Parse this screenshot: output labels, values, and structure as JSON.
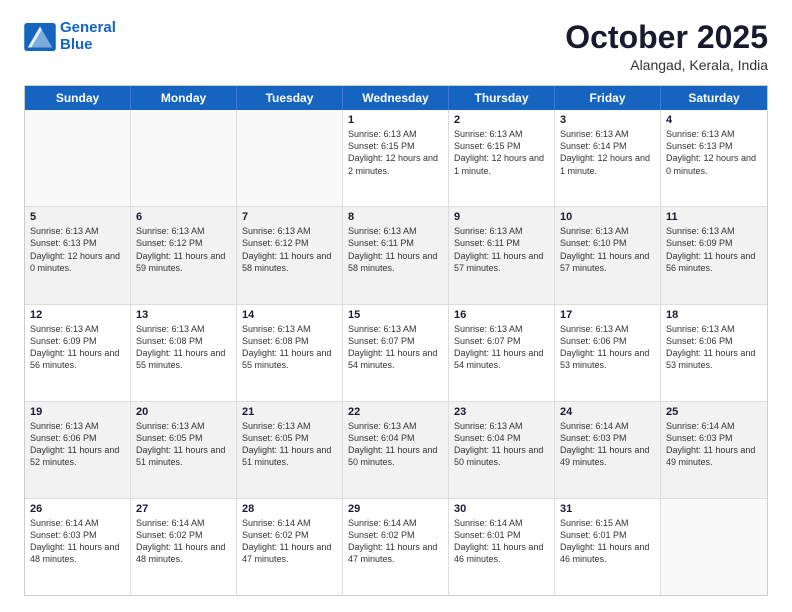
{
  "logo": {
    "line1": "General",
    "line2": "Blue"
  },
  "title": "October 2025",
  "location": "Alangad, Kerala, India",
  "weekdays": [
    "Sunday",
    "Monday",
    "Tuesday",
    "Wednesday",
    "Thursday",
    "Friday",
    "Saturday"
  ],
  "rows": [
    [
      {
        "day": "",
        "text": ""
      },
      {
        "day": "",
        "text": ""
      },
      {
        "day": "",
        "text": ""
      },
      {
        "day": "1",
        "text": "Sunrise: 6:13 AM\nSunset: 6:15 PM\nDaylight: 12 hours and 2 minutes."
      },
      {
        "day": "2",
        "text": "Sunrise: 6:13 AM\nSunset: 6:15 PM\nDaylight: 12 hours and 1 minute."
      },
      {
        "day": "3",
        "text": "Sunrise: 6:13 AM\nSunset: 6:14 PM\nDaylight: 12 hours and 1 minute."
      },
      {
        "day": "4",
        "text": "Sunrise: 6:13 AM\nSunset: 6:13 PM\nDaylight: 12 hours and 0 minutes."
      }
    ],
    [
      {
        "day": "5",
        "text": "Sunrise: 6:13 AM\nSunset: 6:13 PM\nDaylight: 12 hours and 0 minutes."
      },
      {
        "day": "6",
        "text": "Sunrise: 6:13 AM\nSunset: 6:12 PM\nDaylight: 11 hours and 59 minutes."
      },
      {
        "day": "7",
        "text": "Sunrise: 6:13 AM\nSunset: 6:12 PM\nDaylight: 11 hours and 58 minutes."
      },
      {
        "day": "8",
        "text": "Sunrise: 6:13 AM\nSunset: 6:11 PM\nDaylight: 11 hours and 58 minutes."
      },
      {
        "day": "9",
        "text": "Sunrise: 6:13 AM\nSunset: 6:11 PM\nDaylight: 11 hours and 57 minutes."
      },
      {
        "day": "10",
        "text": "Sunrise: 6:13 AM\nSunset: 6:10 PM\nDaylight: 11 hours and 57 minutes."
      },
      {
        "day": "11",
        "text": "Sunrise: 6:13 AM\nSunset: 6:09 PM\nDaylight: 11 hours and 56 minutes."
      }
    ],
    [
      {
        "day": "12",
        "text": "Sunrise: 6:13 AM\nSunset: 6:09 PM\nDaylight: 11 hours and 56 minutes."
      },
      {
        "day": "13",
        "text": "Sunrise: 6:13 AM\nSunset: 6:08 PM\nDaylight: 11 hours and 55 minutes."
      },
      {
        "day": "14",
        "text": "Sunrise: 6:13 AM\nSunset: 6:08 PM\nDaylight: 11 hours and 55 minutes."
      },
      {
        "day": "15",
        "text": "Sunrise: 6:13 AM\nSunset: 6:07 PM\nDaylight: 11 hours and 54 minutes."
      },
      {
        "day": "16",
        "text": "Sunrise: 6:13 AM\nSunset: 6:07 PM\nDaylight: 11 hours and 54 minutes."
      },
      {
        "day": "17",
        "text": "Sunrise: 6:13 AM\nSunset: 6:06 PM\nDaylight: 11 hours and 53 minutes."
      },
      {
        "day": "18",
        "text": "Sunrise: 6:13 AM\nSunset: 6:06 PM\nDaylight: 11 hours and 53 minutes."
      }
    ],
    [
      {
        "day": "19",
        "text": "Sunrise: 6:13 AM\nSunset: 6:06 PM\nDaylight: 11 hours and 52 minutes."
      },
      {
        "day": "20",
        "text": "Sunrise: 6:13 AM\nSunset: 6:05 PM\nDaylight: 11 hours and 51 minutes."
      },
      {
        "day": "21",
        "text": "Sunrise: 6:13 AM\nSunset: 6:05 PM\nDaylight: 11 hours and 51 minutes."
      },
      {
        "day": "22",
        "text": "Sunrise: 6:13 AM\nSunset: 6:04 PM\nDaylight: 11 hours and 50 minutes."
      },
      {
        "day": "23",
        "text": "Sunrise: 6:13 AM\nSunset: 6:04 PM\nDaylight: 11 hours and 50 minutes."
      },
      {
        "day": "24",
        "text": "Sunrise: 6:14 AM\nSunset: 6:03 PM\nDaylight: 11 hours and 49 minutes."
      },
      {
        "day": "25",
        "text": "Sunrise: 6:14 AM\nSunset: 6:03 PM\nDaylight: 11 hours and 49 minutes."
      }
    ],
    [
      {
        "day": "26",
        "text": "Sunrise: 6:14 AM\nSunset: 6:03 PM\nDaylight: 11 hours and 48 minutes."
      },
      {
        "day": "27",
        "text": "Sunrise: 6:14 AM\nSunset: 6:02 PM\nDaylight: 11 hours and 48 minutes."
      },
      {
        "day": "28",
        "text": "Sunrise: 6:14 AM\nSunset: 6:02 PM\nDaylight: 11 hours and 47 minutes."
      },
      {
        "day": "29",
        "text": "Sunrise: 6:14 AM\nSunset: 6:02 PM\nDaylight: 11 hours and 47 minutes."
      },
      {
        "day": "30",
        "text": "Sunrise: 6:14 AM\nSunset: 6:01 PM\nDaylight: 11 hours and 46 minutes."
      },
      {
        "day": "31",
        "text": "Sunrise: 6:15 AM\nSunset: 6:01 PM\nDaylight: 11 hours and 46 minutes."
      },
      {
        "day": "",
        "text": ""
      }
    ]
  ]
}
